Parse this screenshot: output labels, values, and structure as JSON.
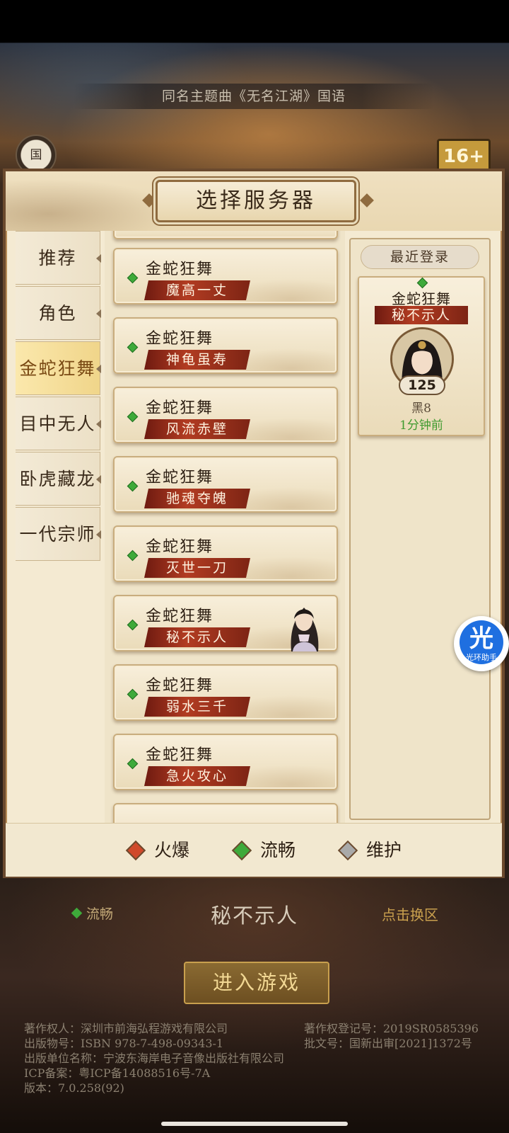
{
  "background": {
    "song_text": "同名主题曲《无名江湖》国语",
    "guo_badge": "国",
    "age_badge": "16+"
  },
  "modal": {
    "title": "选择服务器",
    "tabs": [
      {
        "label": "推荐",
        "active": false
      },
      {
        "label": "角色",
        "active": false
      },
      {
        "label": "金蛇狂舞",
        "active": true
      },
      {
        "label": "目中无人",
        "active": false
      },
      {
        "label": "卧虎藏龙",
        "active": false
      },
      {
        "label": "一代宗师",
        "active": false
      }
    ],
    "servers": [
      {
        "zone": "金蛇狂舞",
        "name": "魔高一丈",
        "status": "流畅"
      },
      {
        "zone": "金蛇狂舞",
        "name": "神龟虽寿",
        "status": "流畅"
      },
      {
        "zone": "金蛇狂舞",
        "name": "风流赤壁",
        "status": "流畅"
      },
      {
        "zone": "金蛇狂舞",
        "name": "驰魂夺魄",
        "status": "流畅"
      },
      {
        "zone": "金蛇狂舞",
        "name": "灭世一刀",
        "status": "流畅"
      },
      {
        "zone": "金蛇狂舞",
        "name": "秘不示人",
        "status": "流畅",
        "has_character": true
      },
      {
        "zone": "金蛇狂舞",
        "name": "弱水三千",
        "status": "流畅"
      },
      {
        "zone": "金蛇狂舞",
        "name": "急火攻心",
        "status": "流畅"
      }
    ],
    "recent": {
      "title": "最近登录",
      "zone": "金蛇狂舞",
      "server": "秘不示人",
      "level": "125",
      "role_name": "黑8",
      "time_ago": "1分钟前"
    },
    "legend": [
      {
        "label": "火爆",
        "color": "#d0492a"
      },
      {
        "label": "流畅",
        "color": "#3eaa3a"
      },
      {
        "label": "维护",
        "color": "#a9a9a9"
      }
    ]
  },
  "footer": {
    "status_label": "流畅",
    "current_server": "秘不示人",
    "switch_label": "点击换区",
    "enter_button": "进入游戏",
    "credits": {
      "copyright_owner": "著作权人：深圳市前海弘程游戏有限公司",
      "copyright_reg": "著作权登记号：2019SR0585396",
      "publish_no": "出版物号：ISBN 978-7-498-09343-1",
      "approval_no": "批文号：国新出审[2021]1372号",
      "publisher": "出版单位名称：宁波东海岸电子音像出版社有限公司",
      "icp": "ICP备案：粤ICP备14088516号-7A",
      "version": "版本：7.0.258(92)"
    }
  },
  "assistant": {
    "glyph": "光",
    "caption": "光环助手"
  }
}
